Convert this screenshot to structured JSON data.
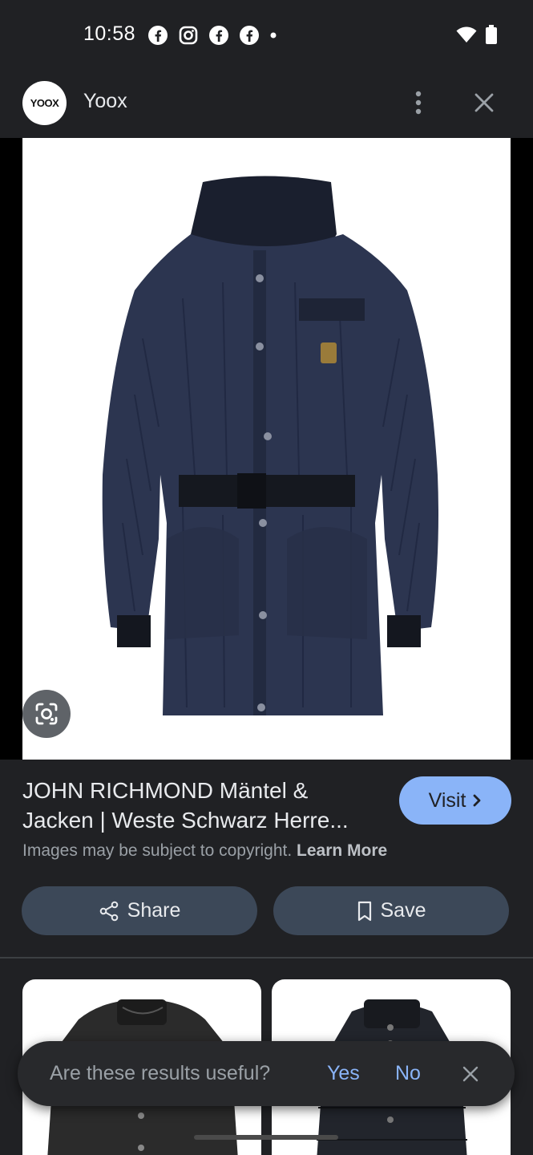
{
  "status_bar": {
    "time": "10:58",
    "notification_icons": [
      "facebook-icon",
      "instagram-icon",
      "facebook-icon",
      "facebook-icon",
      "dot-icon"
    ],
    "system_icons": [
      "wifi-icon",
      "battery-icon"
    ]
  },
  "header": {
    "logo_text": "YOOX",
    "site_name": "Yoox",
    "more_icon": "more-vert-icon",
    "close_icon": "close-icon"
  },
  "product": {
    "image_alt": "Navy quilted belted parka with hood",
    "lens_icon": "google-lens-icon"
  },
  "info": {
    "title_line1": "JOHN RICHMOND Mäntel &",
    "title_line2": "Jacken | Weste Schwarz Herre...",
    "visit_label": "Visit",
    "copyright_text": "Images may be subject to copyright.",
    "learn_more_label": "Learn More"
  },
  "actions": {
    "share_label": "Share",
    "save_label": "Save"
  },
  "feedback": {
    "question": "Are these results useful?",
    "yes_label": "Yes",
    "no_label": "No"
  },
  "colors": {
    "background": "#202124",
    "accent": "#8ab4f8",
    "button_bg": "#3c4858"
  }
}
